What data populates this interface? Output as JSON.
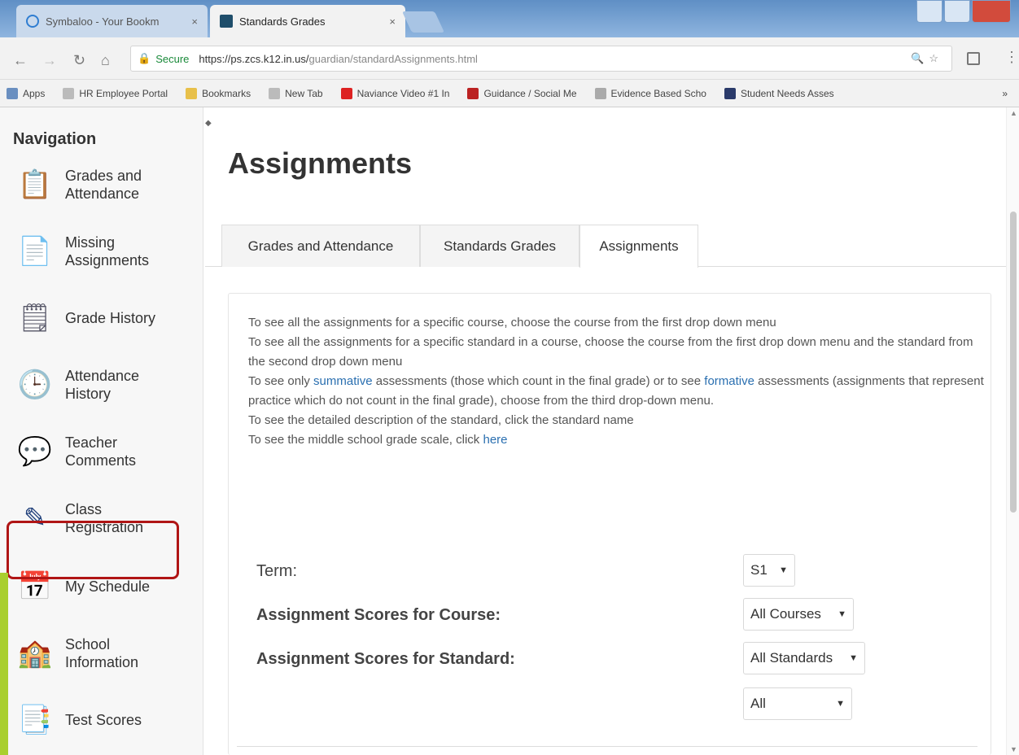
{
  "browser": {
    "tabs": [
      {
        "label": "Symbaloo - Your Bookm"
      },
      {
        "label": "Standards Grades"
      }
    ],
    "tab_close": "×",
    "address": {
      "secure_label": "Secure",
      "url_host": "https://ps.zcs.k12.in.us/",
      "url_path": "guardian/standardAssignments.html"
    },
    "bookmarks": [
      {
        "label": "Apps",
        "icon": "apps-grid-icon",
        "color": "#6a8fc0"
      },
      {
        "label": "HR Employee Portal",
        "icon": "page-icon",
        "color": "#bbbbbb"
      },
      {
        "label": "Bookmarks",
        "icon": "folder-icon",
        "color": "#e8c04a"
      },
      {
        "label": "New Tab",
        "icon": "page-icon",
        "color": "#bbbbbb"
      },
      {
        "label": "Naviance Video #1 In",
        "icon": "youtube-icon",
        "color": "#d22"
      },
      {
        "label": "Guidance / Social Me",
        "icon": "site-icon",
        "color": "#b22"
      },
      {
        "label": "Evidence Based Scho",
        "icon": "loading-icon",
        "color": "#aaa"
      },
      {
        "label": "Student Needs Asses",
        "icon": "site-icon",
        "color": "#2a3a6a"
      }
    ],
    "bookmarks_more": "»"
  },
  "sidebar": {
    "heading": "Navigation",
    "items": [
      {
        "label": "Grades and Attendance",
        "icon": "grades-icon",
        "glyph": "📋"
      },
      {
        "label": "Missing Assignments",
        "icon": "missing-assignments-icon",
        "glyph": "📄"
      },
      {
        "label": "Grade History",
        "icon": "grade-history-icon",
        "glyph": "🗒"
      },
      {
        "label": "Attendance History",
        "icon": "attendance-history-icon",
        "glyph": "🕒"
      },
      {
        "label": "Teacher Comments",
        "icon": "comments-icon",
        "glyph": "💬"
      },
      {
        "label": "Class Registration",
        "icon": "class-registration-icon",
        "glyph": "✎"
      },
      {
        "label": "My Schedule",
        "icon": "schedule-icon",
        "glyph": "📅"
      },
      {
        "label": "School Information",
        "icon": "school-icon",
        "glyph": "🏫"
      },
      {
        "label": "Test Scores",
        "icon": "test-scores-icon",
        "glyph": "📑"
      }
    ],
    "highlight_color": "#b01515",
    "accent_bar_color": "#a9cf2f"
  },
  "main": {
    "title": "Assignments",
    "tabs": [
      {
        "label": "Grades and Attendance"
      },
      {
        "label": "Standards Grades"
      },
      {
        "label": "Assignments"
      }
    ],
    "active_tab": "Assignments",
    "instructions": {
      "line1": "To see all the assignments for a specific course, choose the course from the first drop down menu",
      "line2": "To see all the assignments for a specific standard in a course, choose the course from the first drop down menu and the standard from the second drop down menu",
      "line3_pre": "To see only ",
      "line3_link1": "summative",
      "line3_mid": " assessments (those which count in the final grade) or to see ",
      "line3_link2": "formative",
      "line3_post": " assessments (assignments that represent practice which do not count in the final grade), choose from the third drop-down menu.",
      "line4": "To see the detailed description of the standard, click the standard name",
      "line5_pre": "To see the middle school grade scale, click ",
      "line5_link": "here"
    },
    "filters": {
      "term_label": "Term:",
      "term_value": "S1",
      "course_label": "Assignment Scores for Course:",
      "course_value": "All Courses",
      "standard_label": "Assignment Scores for Standard:",
      "standard_value": "All Standards",
      "type_value": "All"
    }
  }
}
